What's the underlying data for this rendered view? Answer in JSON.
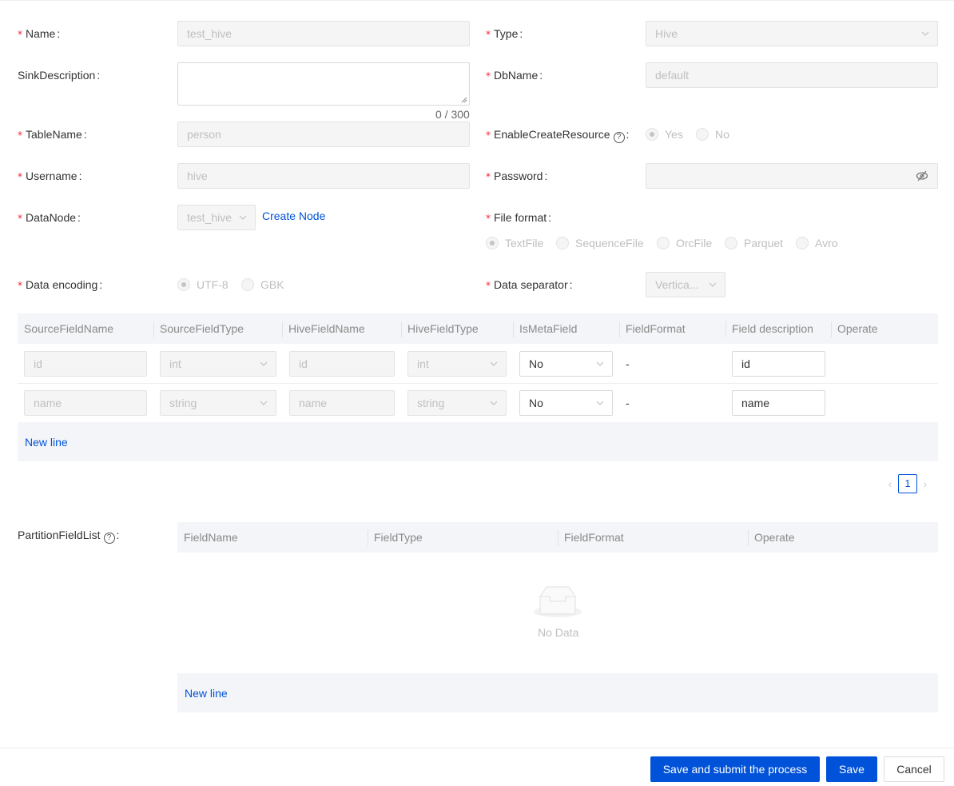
{
  "form": {
    "name": {
      "label": "Name",
      "value": "test_hive"
    },
    "type": {
      "label": "Type",
      "value": "Hive"
    },
    "sink_description": {
      "label": "SinkDescription",
      "value": "",
      "counter": "0 / 300"
    },
    "db_name": {
      "label": "DbName",
      "value": "default"
    },
    "table_name": {
      "label": "TableName",
      "value": "person"
    },
    "enable_create_resource": {
      "label": "EnableCreateResource",
      "options": [
        "Yes",
        "No"
      ],
      "selected": "Yes"
    },
    "username": {
      "label": "Username",
      "value": "hive"
    },
    "password": {
      "label": "Password",
      "value": ""
    },
    "data_node": {
      "label": "DataNode",
      "value": "test_hive",
      "create_link": "Create Node"
    },
    "file_format": {
      "label": "File format",
      "options": [
        "TextFile",
        "SequenceFile",
        "OrcFile",
        "Parquet",
        "Avro"
      ],
      "selected": "TextFile"
    },
    "data_encoding": {
      "label": "Data encoding",
      "options": [
        "UTF-8",
        "GBK"
      ],
      "selected": "UTF-8"
    },
    "data_separator": {
      "label": "Data separator",
      "value": "Vertica..."
    }
  },
  "fields_table": {
    "columns": [
      "SourceFieldName",
      "SourceFieldType",
      "HiveFieldName",
      "HiveFieldType",
      "IsMetaField",
      "FieldFormat",
      "Field description",
      "Operate"
    ],
    "rows": [
      {
        "source_name": "id",
        "source_type": "int",
        "hive_name": "id",
        "hive_type": "int",
        "is_meta": "No",
        "format": "-",
        "description": "id"
      },
      {
        "source_name": "name",
        "source_type": "string",
        "hive_name": "name",
        "hive_type": "string",
        "is_meta": "No",
        "format": "-",
        "description": "name"
      }
    ],
    "new_line": "New line",
    "pagination": {
      "current": "1"
    }
  },
  "partition": {
    "label": "PartitionFieldList",
    "columns": [
      "FieldName",
      "FieldType",
      "FieldFormat",
      "Operate"
    ],
    "empty_text": "No Data",
    "new_line": "New line"
  },
  "footer": {
    "submit_label": "Save and submit the process",
    "save_label": "Save",
    "cancel_label": "Cancel"
  },
  "colors": {
    "primary": "#0052d9",
    "required": "#f5222d"
  }
}
